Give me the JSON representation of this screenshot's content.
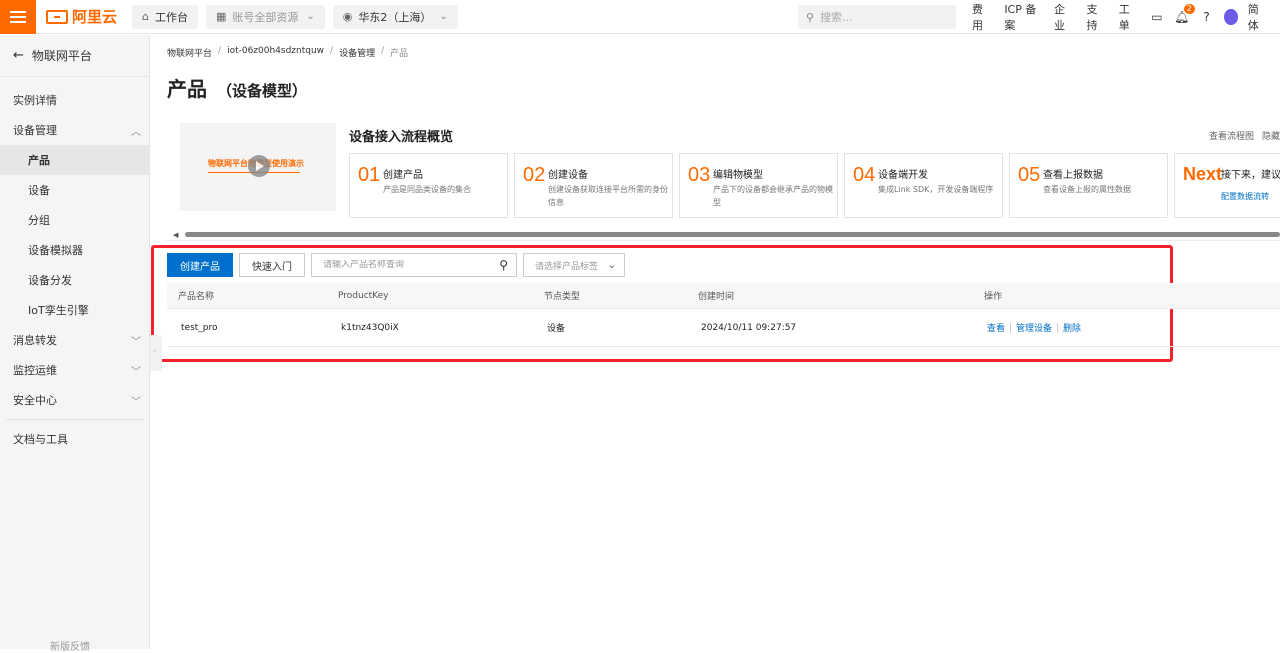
{
  "topbar": {
    "logo_text": "阿里云",
    "workbench": "工作台",
    "account_scope": "账号全部资源",
    "region": "华东2（上海）",
    "search_placeholder": "搜索...",
    "links": [
      "费用",
      "ICP 备案",
      "企业",
      "支持",
      "工单"
    ],
    "notification_count": "2",
    "language": "简体",
    "brand_color": "#ff6a00"
  },
  "sidebar": {
    "back_label": "物联网平台",
    "items": [
      {
        "label": "实例详情",
        "level": 1
      },
      {
        "label": "设备管理",
        "level": 1,
        "expanded": true
      },
      {
        "label": "产品",
        "level": 2,
        "active": true
      },
      {
        "label": "设备",
        "level": 2
      },
      {
        "label": "分组",
        "level": 2
      },
      {
        "label": "设备模拟器",
        "level": 2
      },
      {
        "label": "设备分发",
        "level": 2
      },
      {
        "label": "IoT孪生引擎",
        "level": 2
      },
      {
        "label": "消息转发",
        "level": 1
      },
      {
        "label": "监控运维",
        "level": 1
      },
      {
        "label": "安全中心",
        "level": 1
      },
      {
        "label": "文档与工具",
        "level": 1
      }
    ],
    "footer": "新版反馈"
  },
  "breadcrumb": [
    "物联网平台",
    "iot-06z00h4sdzntquw",
    "设备管理",
    "产品"
  ],
  "page": {
    "title": "产品",
    "subtitle": "（设备模型）"
  },
  "overview": {
    "video_text": "物联网平台物模型使用演示",
    "title": "设备接入流程概览",
    "link_flowchart": "查看流程图",
    "link_hide": "隐藏",
    "steps": [
      {
        "num": "01",
        "title": "创建产品",
        "desc": "产品是同品类设备的集合"
      },
      {
        "num": "02",
        "title": "创建设备",
        "desc": "创建设备获取连接平台所需的身份信息"
      },
      {
        "num": "03",
        "title": "编辑物模型",
        "desc": "产品下的设备都会继承产品的物模型"
      },
      {
        "num": "04",
        "title": "设备端开发",
        "desc": "集成Link SDK，开发设备端程序"
      },
      {
        "num": "05",
        "title": "查看上报数据",
        "desc": "查看设备上报的属性数据"
      }
    ],
    "next": {
      "num": "Next",
      "title": "接下来，建议",
      "link": "配置数据流转"
    }
  },
  "toolbar": {
    "create_label": "创建产品",
    "quickstart_label": "快速入门",
    "search_placeholder": "请输入产品名称查询",
    "tag_placeholder": "请选择产品标签"
  },
  "table": {
    "columns": [
      "产品名称",
      "ProductKey",
      "节点类型",
      "创建时间",
      "操作"
    ],
    "rows": [
      {
        "name": "test_pro",
        "key": "k1tnz43Q0iX",
        "node_type": "设备",
        "created": "2024/10/11 09:27:57",
        "actions": [
          "查看",
          "管理设备",
          "删除"
        ]
      }
    ]
  },
  "accent_color": "#0070cc",
  "highlight_color": "#f5222d"
}
